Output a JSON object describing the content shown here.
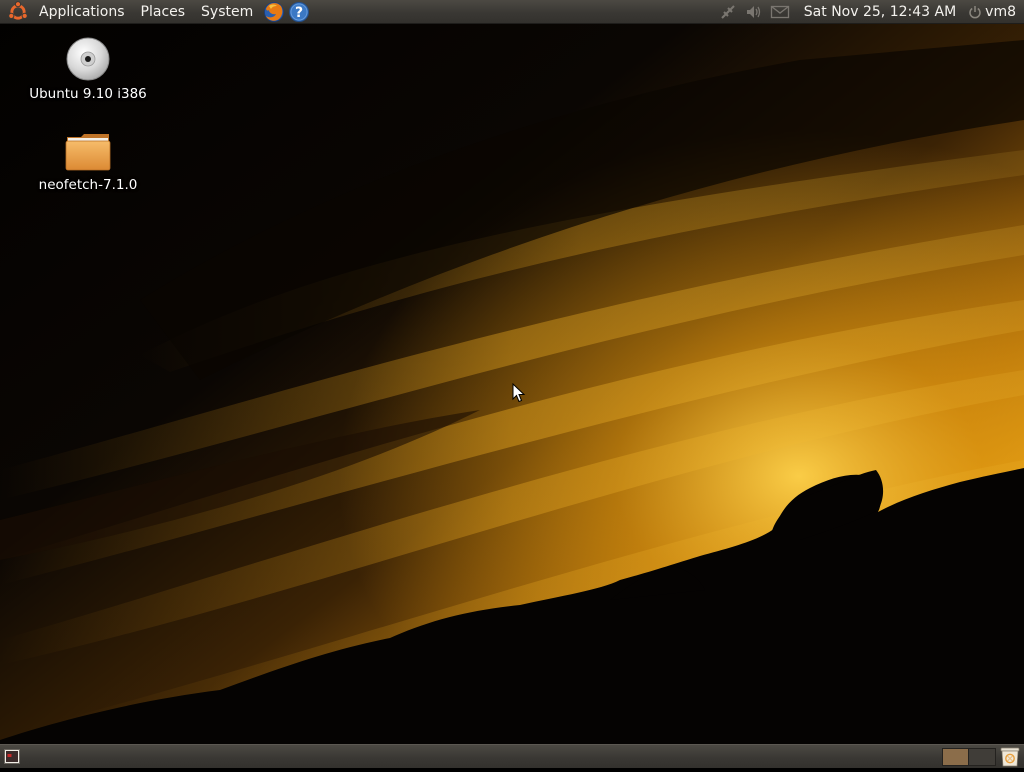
{
  "top_panel": {
    "menus": [
      "Applications",
      "Places",
      "System"
    ],
    "launchers": [
      "firefox-icon",
      "help-icon"
    ],
    "tray_icons": [
      "network-icon",
      "volume-muted-icon",
      "mail-icon"
    ],
    "clock": "Sat Nov 25, 12:43 AM",
    "user": "vm8"
  },
  "desktop": {
    "icons": [
      {
        "label": "Ubuntu 9.10 i386",
        "icon": "cdrom-icon"
      },
      {
        "label": "neofetch-7.1.0",
        "icon": "folder-icon"
      }
    ]
  },
  "bottom_panel": {
    "workspaces": 2,
    "active_workspace": 1
  },
  "colors": {
    "panel": "#3c3a36",
    "sky_glow": "#f0a010",
    "folder": "#e8a048"
  }
}
